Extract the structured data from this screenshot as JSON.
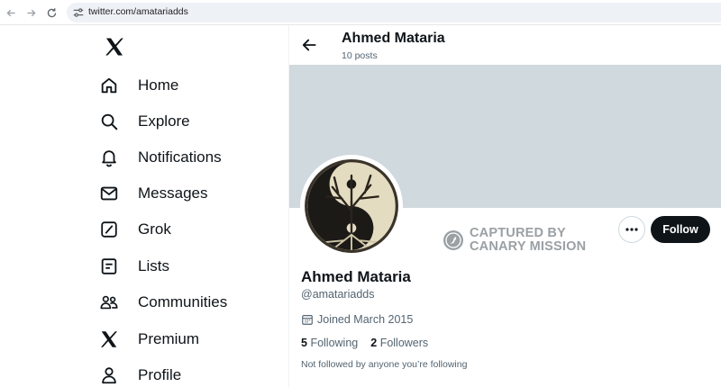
{
  "browser": {
    "url": "twitter.com/amatariadds"
  },
  "sidebar": {
    "items": [
      {
        "label": "Home",
        "icon": "home-icon"
      },
      {
        "label": "Explore",
        "icon": "search-icon"
      },
      {
        "label": "Notifications",
        "icon": "bell-icon"
      },
      {
        "label": "Messages",
        "icon": "envelope-icon"
      },
      {
        "label": "Grok",
        "icon": "grok-icon"
      },
      {
        "label": "Lists",
        "icon": "list-icon"
      },
      {
        "label": "Communities",
        "icon": "communities-icon"
      },
      {
        "label": "Premium",
        "icon": "x-logo-icon"
      },
      {
        "label": "Profile",
        "icon": "person-icon"
      }
    ]
  },
  "header": {
    "name": "Ahmed Mataria",
    "posts": "10 posts"
  },
  "watermark": {
    "line1": "CAPTURED BY",
    "line2": "CANARY MISSION"
  },
  "profile": {
    "name": "Ahmed Mataria",
    "handle": "@amatariadds",
    "joined": "Joined March 2015",
    "following_count": "5",
    "following_label": "Following",
    "followers_count": "2",
    "followers_label": "Followers",
    "not_followed": "Not followed by anyone you’re following",
    "follow_label": "Follow"
  },
  "colors": {
    "banner": "#cfd9de",
    "follow_button": "#0f1419",
    "secondary_text": "#536471"
  }
}
